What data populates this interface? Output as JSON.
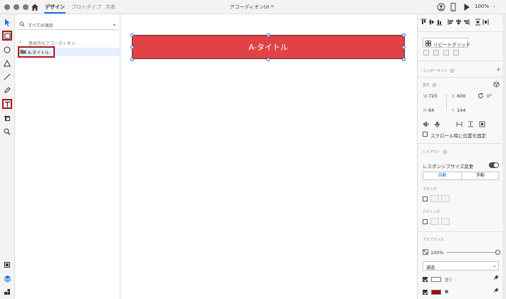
{
  "titlebar": {
    "tabs": {
      "design": "デザイン",
      "prototype": "プロトタイプ",
      "share": "共有"
    },
    "doc_title": "アコーディオンUI *",
    "doc_chevron": "⌄",
    "zoom": "100%",
    "zoom_chevron": "⌄"
  },
  "layers": {
    "search_placeholder": "すべての項目",
    "search_chevron": "⌄",
    "back_arrow": "‹",
    "breadcrumb": "基本的なアコーディオン",
    "items": [
      {
        "label": "A-タイトル",
        "selected": true
      }
    ]
  },
  "canvas": {
    "element": {
      "label": "A-タイトル",
      "fill": "#e14245",
      "selected": true
    }
  },
  "inspector": {
    "repeat_grid_label": "リピートグリッド",
    "components_title": "コンポーネント",
    "add": "+",
    "transform_title": "変形",
    "w_label": "W",
    "w_value": "720",
    "x_label": "X",
    "x_value": "600",
    "h_label": "H",
    "h_value": "64",
    "y_label": "Y",
    "y_value": "144",
    "rotation_value": "0°",
    "fix_position_label": "スクロール時に位置を固定",
    "fix_position_checked": false,
    "layout_title": "レイアウト",
    "responsive_label": "レスポンシブサイズ変更",
    "responsive_on": true,
    "auto_label": "自動",
    "manual_label": "手動",
    "stack_title": "スタック",
    "padding_title": "パディング",
    "appearance_title": "アピアランス",
    "opacity_label": "100%",
    "opacity_value": 1.0,
    "blend_mode": "通過",
    "blend_chevron": "⌄",
    "fill_label": "塗り",
    "fill_checked": true,
    "fill_color": "#ffffff",
    "border_color": "#a10f12",
    "border_checked": true,
    "border_label": "■"
  },
  "colors": {
    "accent": "#1473e6",
    "highlight": "#b0151b",
    "rect_fill": "#e14245"
  }
}
